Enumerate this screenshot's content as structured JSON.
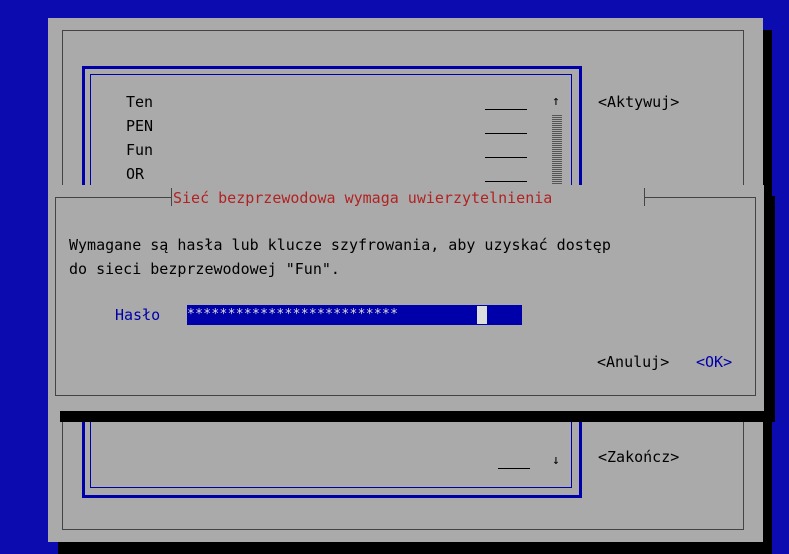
{
  "background_dialog": {
    "list_items": [
      "Ten",
      "PEN",
      "Fun",
      "OR"
    ],
    "scroll_up_arrow": "↑",
    "scroll_down_arrow": "↓",
    "activate_button": "<Aktywuj>",
    "quit_button": "<Zakończ>"
  },
  "auth_dialog": {
    "title": "Sieć bezprzewodowa wymaga uwierzytelnienia",
    "message_line1": "Wymagane są hasła lub klucze szyfrowania, aby uzyskać dostęp",
    "message_line2": "do sieci bezprzewodowej \"Fun\".",
    "password_label": "Hasło",
    "password_value": "**************************",
    "cancel_button": "<Anuluj>",
    "ok_button": "<OK>"
  },
  "colors": {
    "screen_background": "#0b0bb0",
    "panel": "#aaaaaa",
    "title": "#b22222",
    "focus": "#0000aa"
  }
}
